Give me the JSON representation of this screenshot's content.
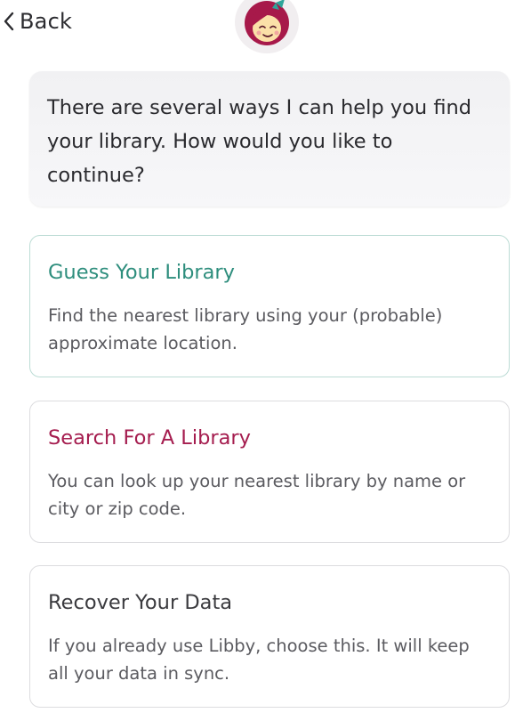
{
  "header": {
    "back_label": "Back"
  },
  "icons": {
    "back": "chevron-left-icon",
    "avatar": "libby-logo-icon"
  },
  "bubble": {
    "text": "There are several ways I can help you find your library. How would you like to continue?"
  },
  "options": [
    {
      "title": "Guess Your Library",
      "description": "Find the nearest library using your (probable) approximate location.",
      "title_color": "#2e8e7d"
    },
    {
      "title": "Search For A Library",
      "description": "You can look up your nearest library by name or city or zip code.",
      "title_color": "#a51d4f"
    },
    {
      "title": "Recover Your Data",
      "description": "If you already use Libby, choose this. It will keep all your data in sync.",
      "title_color": "#3b3b3f"
    }
  ],
  "colors": {
    "logo_red": "#a7194a",
    "logo_teal": "#2fa59a",
    "logo_face": "#fbe0a8"
  }
}
